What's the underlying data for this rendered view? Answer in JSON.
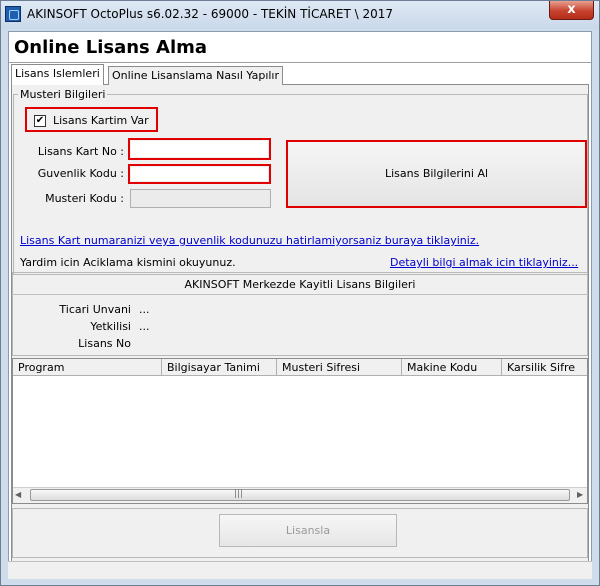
{
  "window": {
    "title": "AKINSOFT OctoPlus s6.02.32  -  69000 - TEKİN TİCARET \\ 2017",
    "close_glyph": "x"
  },
  "page": {
    "title": "Online Lisans Alma"
  },
  "tabs": [
    {
      "label": "Lisans Islemleri",
      "selected": true
    },
    {
      "label": "Online Lisanslama Nasıl Yapılır",
      "selected": false
    }
  ],
  "customer": {
    "legend": "Musteri Bilgileri",
    "checkbox": {
      "label": "Lisans Kartim Var",
      "checked": true,
      "glyph": "✔"
    },
    "fields": {
      "card_no_label": "Lisans Kart No :",
      "card_no_value": "",
      "security_label": "Guvenlik Kodu :",
      "security_value": "",
      "customer_code_label": "Musteri Kodu :",
      "customer_code_value": ""
    },
    "get_button": "Lisans Bilgilerini Al"
  },
  "links": {
    "forgot": "Lisans Kart numaranizi veya guvenlik kodunuzu hatirlamiyorsaniz buraya tiklayiniz.",
    "help_text": "Yardim icin Aciklama kismini okuyunuz.",
    "details": "Detayli bilgi almak icin tiklayiniz..."
  },
  "info": {
    "title": "AKINSOFT Merkezde Kayitli Lisans Bilgileri",
    "ticari_label": "Ticari Unvani",
    "ticari_value": "...",
    "yetkili_label": "Yetkilisi",
    "yetkili_value": "...",
    "lisans_no_label": "Lisans No"
  },
  "grid": {
    "columns": [
      "Program",
      "Bilgisayar Tanimi",
      "Musteri Sifresi",
      "Makine Kodu",
      "Karsilik Sifre"
    ],
    "rows": [],
    "scroll": {
      "left_glyph": "◀",
      "right_glyph": "▶",
      "grip_glyph": "|||"
    }
  },
  "footer": {
    "license_button": "Lisansla",
    "license_button_enabled": false
  },
  "colors": {
    "highlight": "#e00000",
    "link": "#0000cc",
    "titlebar": "#cfdcec",
    "close": "#c7432f"
  }
}
